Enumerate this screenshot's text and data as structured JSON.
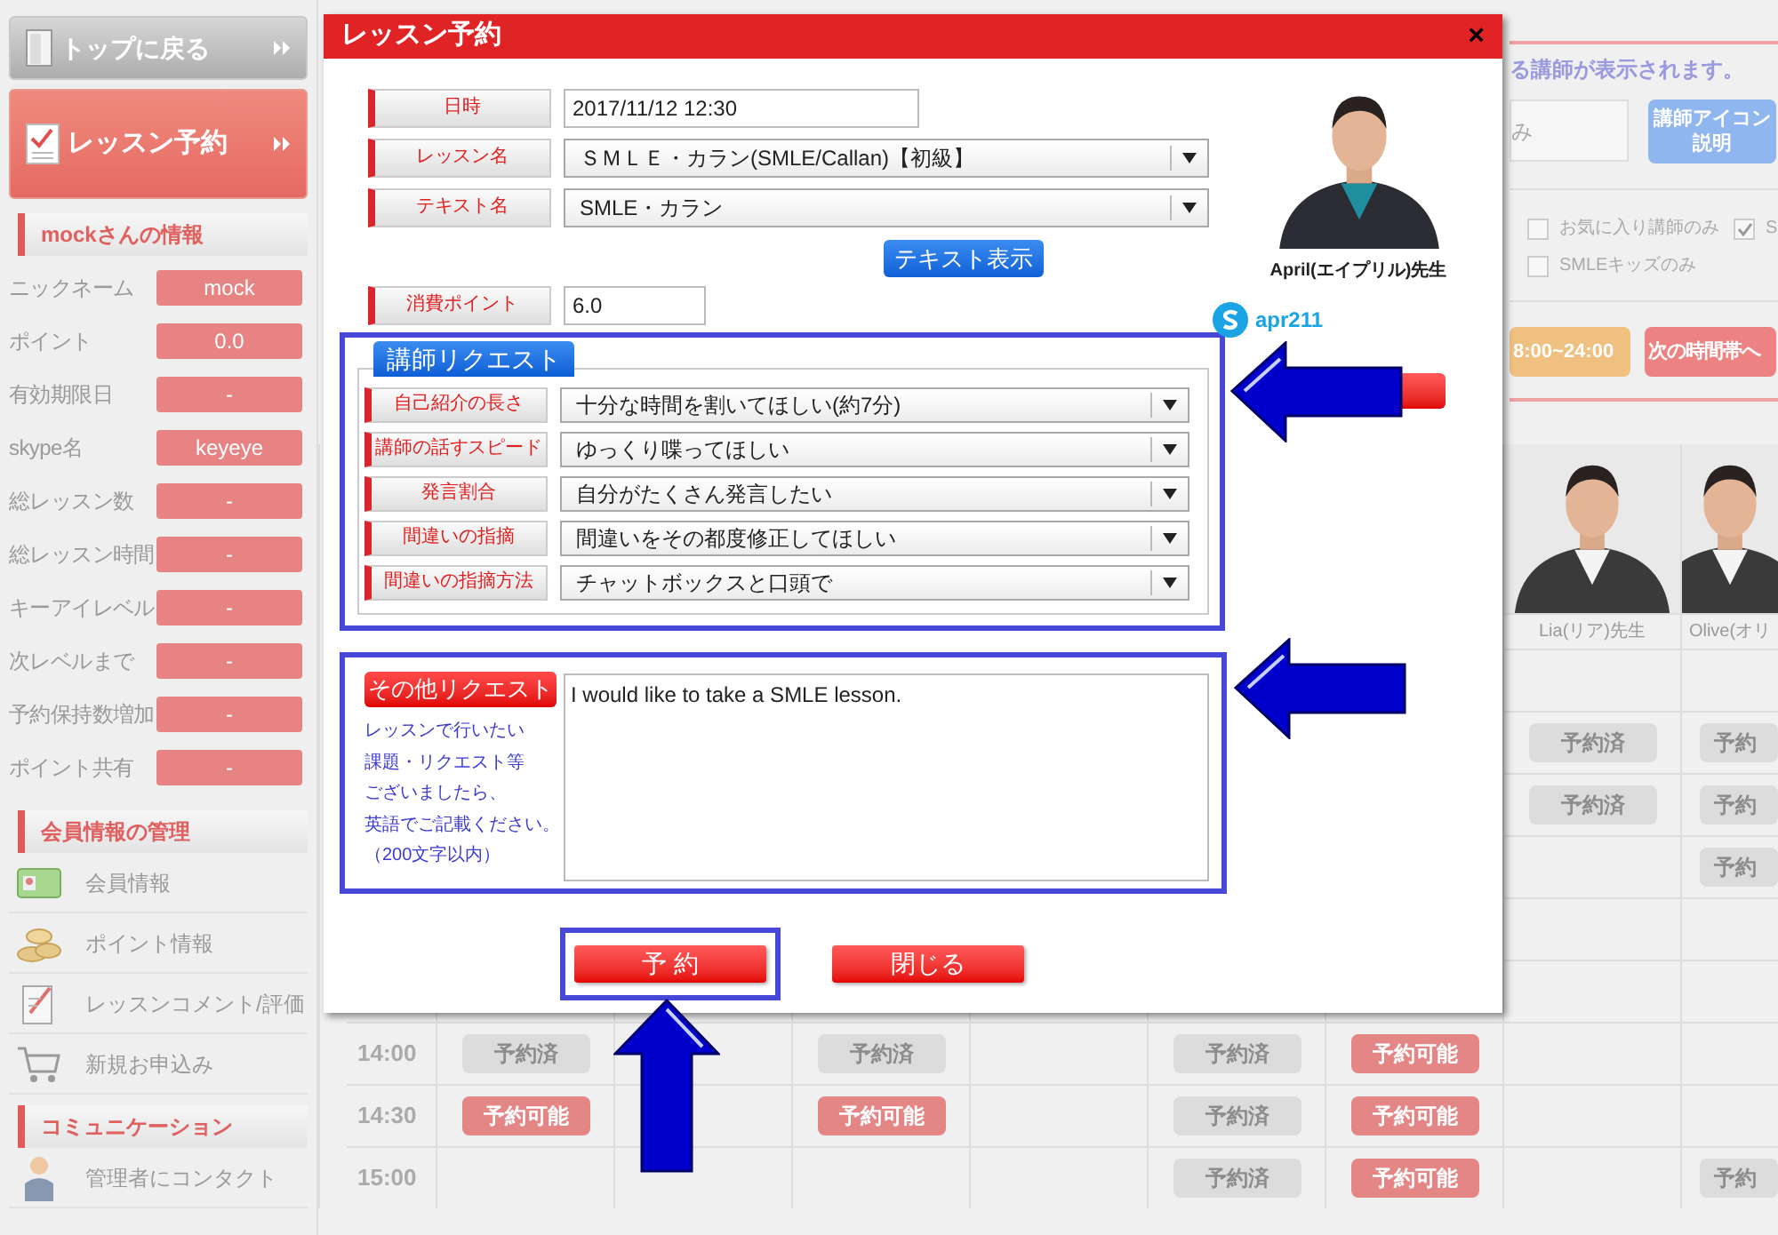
{
  "sidebar": {
    "nav_buttons": [
      {
        "label": "トップに戻る",
        "kind": "back",
        "selected": false
      },
      {
        "label": "レッスン予約",
        "kind": "lesson",
        "selected": true
      }
    ],
    "info_section": {
      "title": "mockさんの情報",
      "rows": [
        {
          "label": "ニックネーム",
          "value": "mock"
        },
        {
          "label": "ポイント",
          "value": "0.0"
        },
        {
          "label": "有効期限日",
          "value": "-"
        },
        {
          "label": "skype名",
          "value": "keyeye"
        },
        {
          "label": "総レッスン数",
          "value": "-"
        },
        {
          "label": "総レッスン時間",
          "value": "-"
        },
        {
          "label": "キーアイレベル",
          "value": "-"
        },
        {
          "label": "次レベルまで",
          "value": "-"
        },
        {
          "label": "予約保持数増加",
          "value": "-"
        },
        {
          "label": "ポイント共有",
          "value": "-"
        }
      ]
    },
    "sections": [
      {
        "title": "会員情報の管理",
        "items": [
          {
            "label": "会員情報",
            "kind": "card"
          },
          {
            "label": "ポイント情報",
            "kind": "coins"
          },
          {
            "label": "レッスンコメント/評価",
            "kind": "clipboard"
          },
          {
            "label": "新規お申込み",
            "kind": "cart"
          }
        ]
      },
      {
        "title": "コミュニケーション",
        "items": [
          {
            "label": "管理者にコンタクト",
            "kind": "person"
          }
        ]
      }
    ]
  },
  "background": {
    "notice": "る講師が表示されます。",
    "search_value": "み",
    "help_button": [
      "講師アイコン",
      "説明"
    ],
    "filters": [
      [
        {
          "label": "お気に入り講師のみ",
          "checked": false
        },
        {
          "label": "S",
          "checked": true
        }
      ],
      [
        {
          "label": "SMLEキッズのみ",
          "checked": false
        }
      ]
    ],
    "time_buttons": [
      {
        "label": "8:00~24:00",
        "kind": "range"
      },
      {
        "label": "次の時間帯へ",
        "kind": "next"
      }
    ],
    "schedule": {
      "teachers": [
        {
          "name": "Lia(リア)先生"
        },
        {
          "name": "Olive(オリ"
        }
      ],
      "rows": [
        {
          "cells": [
            null,
            null,
            null,
            null,
            null,
            null,
            null,
            null
          ]
        },
        {
          "cells": [
            null,
            null,
            null,
            null,
            null,
            null,
            {
              "label": "予約済",
              "kind": "booked"
            },
            {
              "label": "予約",
              "kind": "booked"
            }
          ]
        },
        {
          "cells": [
            null,
            null,
            null,
            null,
            null,
            null,
            {
              "label": "予約済",
              "kind": "booked"
            },
            {
              "label": "予約",
              "kind": "booked"
            }
          ]
        },
        {
          "cells": [
            null,
            null,
            null,
            null,
            null,
            null,
            null,
            {
              "label": "予約",
              "kind": "booked"
            }
          ]
        },
        {
          "cells": [
            null,
            null,
            null,
            null,
            null,
            null,
            null,
            null
          ]
        },
        {
          "cells": [
            null,
            null,
            null,
            null,
            null,
            null,
            null,
            null
          ]
        },
        {
          "time": "14:00",
          "cells": [
            {
              "label": "予約済",
              "kind": "booked"
            },
            null,
            {
              "label": "予約済",
              "kind": "booked"
            },
            null,
            {
              "label": "予約済",
              "kind": "booked"
            },
            {
              "label": "予約可能",
              "kind": "available"
            },
            null,
            null
          ]
        },
        {
          "time": "14:30",
          "cells": [
            {
              "label": "予約可能",
              "kind": "available"
            },
            null,
            {
              "label": "予約可能",
              "kind": "available"
            },
            null,
            {
              "label": "予約済",
              "kind": "booked"
            },
            {
              "label": "予約可能",
              "kind": "available"
            },
            null,
            null
          ]
        },
        {
          "time": "15:00",
          "cells": [
            null,
            null,
            null,
            null,
            {
              "label": "予約済",
              "kind": "booked"
            },
            {
              "label": "予約可能",
              "kind": "available"
            },
            null,
            {
              "label": "予約",
              "kind": "booked"
            }
          ]
        }
      ]
    }
  },
  "modal": {
    "title": "レッスン予約",
    "close": "×",
    "fields": [
      {
        "label": "日時",
        "kind": "date_input",
        "value": "2017/11/12 12:30"
      },
      {
        "label": "レッスン名",
        "kind": "select",
        "value": "ＳＭＬＥ・カラン(SMLE/Callan)【初級】"
      },
      {
        "label": "テキスト名",
        "kind": "select",
        "value": "SMLE・カラン"
      },
      {
        "kind": "button",
        "label": "テキスト表示"
      },
      {
        "label": "消費ポイント",
        "kind": "number_input",
        "value": "6.0"
      }
    ],
    "teacher": {
      "name": "April(エイプリル)先生",
      "skype": "apr211"
    },
    "teacher_request": {
      "title": "講師リクエスト",
      "rows": [
        {
          "label": "自己紹介の長さ",
          "value": "十分な時間を割いてほしい(約7分)"
        },
        {
          "label": "講師の話すスピード",
          "value": "ゆっくり喋ってほしい"
        },
        {
          "label": "発言割合",
          "value": "自分がたくさん発言したい"
        },
        {
          "label": "間違いの指摘",
          "value": "間違いをその都度修正してほしい"
        },
        {
          "label": "間違いの指摘方法",
          "value": "チャットボックスと口頭で"
        }
      ]
    },
    "other_request": {
      "title": "その他リクエスト",
      "hint": [
        "レッスンで行いたい",
        "課題・リクエスト等",
        "ございましたら、",
        "英語でご記載ください。",
        "（200文字以内）"
      ],
      "value": "I would like to take a SMLE lesson."
    },
    "buttons": [
      {
        "label": "予 約",
        "highlighted": true
      },
      {
        "label": "閉じる",
        "highlighted": false
      }
    ]
  }
}
